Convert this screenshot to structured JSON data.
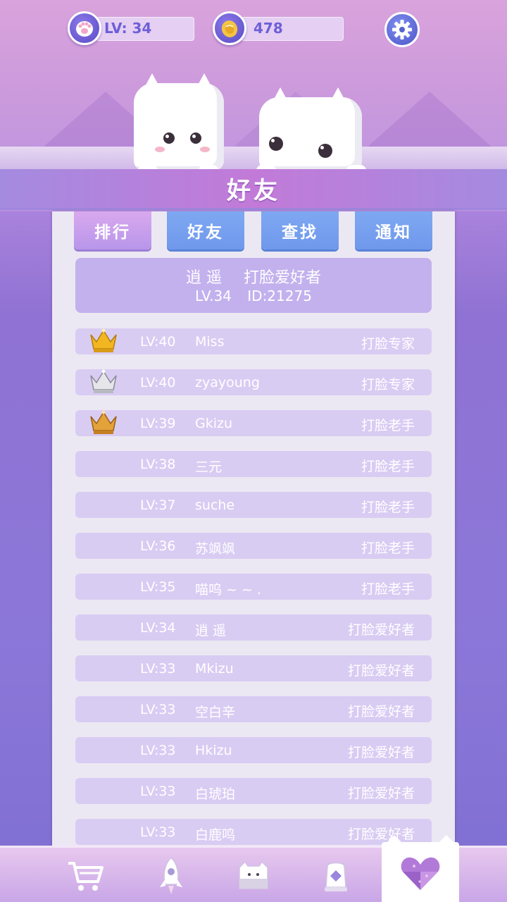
{
  "header": {
    "level_text": "LV: 34",
    "coins_text": "478",
    "banner_title": "好友"
  },
  "tabs": [
    {
      "label": "排行",
      "active": true
    },
    {
      "label": "好友",
      "active": false
    },
    {
      "label": "查找",
      "active": false
    },
    {
      "label": "通知",
      "active": false
    }
  ],
  "me": {
    "name": "逍 遥",
    "title": "打脸爱好者",
    "level": "LV.34",
    "id": "ID:21275"
  },
  "ranking": [
    {
      "crown": "gold",
      "level": "LV:40",
      "name": "Miss",
      "title": "打脸专家"
    },
    {
      "crown": "silver",
      "level": "LV:40",
      "name": "zyayoung",
      "title": "打脸专家"
    },
    {
      "crown": "bronze",
      "level": "LV:39",
      "name": "Gkizu",
      "title": "打脸老手"
    },
    {
      "crown": "",
      "level": "LV:38",
      "name": "三元",
      "title": "打脸老手"
    },
    {
      "crown": "",
      "level": "LV:37",
      "name": "suche",
      "title": "打脸老手"
    },
    {
      "crown": "",
      "level": "LV:36",
      "name": "苏飒飒",
      "title": "打脸老手"
    },
    {
      "crown": "",
      "level": "LV:35",
      "name": "喵呜 ~ ~ .",
      "title": "打脸老手"
    },
    {
      "crown": "",
      "level": "LV:34",
      "name": "逍 遥",
      "title": "打脸爱好者"
    },
    {
      "crown": "",
      "level": "LV:33",
      "name": "Mkizu",
      "title": "打脸爱好者"
    },
    {
      "crown": "",
      "level": "LV:33",
      "name": "空白辛",
      "title": "打脸爱好者"
    },
    {
      "crown": "",
      "level": "LV:33",
      "name": "Hkizu",
      "title": "打脸爱好者"
    },
    {
      "crown": "",
      "level": "LV:33",
      "name": "白琥珀",
      "title": "打脸爱好者"
    },
    {
      "crown": "",
      "level": "LV:33",
      "name": "白鹿鸣",
      "title": "打脸爱好者"
    }
  ],
  "bottom_nav": [
    {
      "icon": "shop-cart-icon",
      "active": false
    },
    {
      "icon": "rocket-icon",
      "active": false
    },
    {
      "icon": "cat-home-icon",
      "active": false
    },
    {
      "icon": "gem-pedestal-icon",
      "active": false
    },
    {
      "icon": "heart-friends-icon",
      "active": true
    }
  ],
  "colors": {
    "accent_purple": "#b896ea",
    "tab_blue": "#7fa8f2",
    "row_bg": "#d9ccf3",
    "crown_gold": "#f2b720",
    "crown_silver": "#d8d8dc",
    "crown_bronze": "#d9932c"
  }
}
